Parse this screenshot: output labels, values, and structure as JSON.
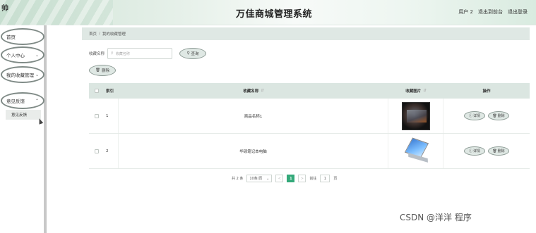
{
  "header": {
    "logo_char": "帅",
    "title": "万佳商城管理系统",
    "user_label": "用户 2",
    "to_frontend": "退出到前台",
    "logout": "退出登录"
  },
  "sidebar": {
    "items": [
      {
        "label": "首页"
      },
      {
        "label": "个人中心"
      },
      {
        "label": "我的收藏管理"
      },
      {
        "label": "意见反馈"
      }
    ],
    "submenu": {
      "label": "意见反馈"
    }
  },
  "breadcrumb": {
    "home": "首页",
    "separator": "/",
    "current": "我的收藏管理"
  },
  "search": {
    "label": "收藏名称",
    "placeholder": "收藏名称",
    "query_label": "查询"
  },
  "actions": {
    "batch_delete": "删除"
  },
  "table": {
    "columns": {
      "index": "索引",
      "name": "收藏名称",
      "image": "收藏图片",
      "op": "操作"
    },
    "rows": [
      {
        "index": "1",
        "name": "商品名称1",
        "image": "monitor-photo",
        "detail": "详情",
        "delete": "删除"
      },
      {
        "index": "2",
        "name": "华硕笔记本电脑",
        "image": "laptop-photo",
        "detail": "详情",
        "delete": "删除"
      }
    ]
  },
  "pagination": {
    "total": "共 2 条",
    "page_size": "10条/页",
    "prev": "<",
    "current": "1",
    "next": ">",
    "goto_label": "前往",
    "goto_value": "1",
    "page_unit": "页"
  },
  "watermark": "CSDN @洋洋  程序",
  "colors": {
    "accent": "#34a97a",
    "header_bg": "#dbe6e1",
    "button_border": "#8c9a94"
  }
}
